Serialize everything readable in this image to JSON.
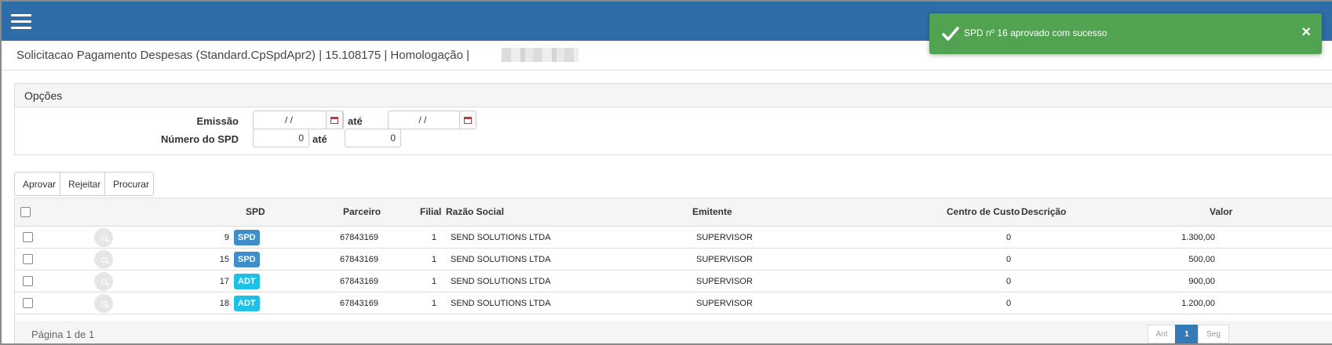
{
  "header": {
    "menu_icon": "hamburger-menu-icon",
    "bg_color": "#2f6da8"
  },
  "page": {
    "title": "Solicitacao Pagamento Despesas (Standard.CpSpdApr2) | 15.108175 | Homologação |"
  },
  "options": {
    "heading": "Opções",
    "emissao_label": "Emissão",
    "emissao_from": "/ /",
    "emissao_to": "/ /",
    "ate_label": "até",
    "numero_label": "Número do SPD",
    "numero_from": "0",
    "numero_to": "0",
    "calendar_icon": "calendar-icon"
  },
  "actions": {
    "approve": "Aprovar",
    "reject": "Rejeitar",
    "search": "Procurar"
  },
  "table": {
    "columns": {
      "spd": "SPD",
      "parceiro": "Parceiro",
      "filial": "Filial",
      "razao": "Razão Social",
      "emitente": "Emitente",
      "centro": "Centro de Custo",
      "descricao": "Descrição",
      "valor": "Valor"
    },
    "rows": [
      {
        "spd": "9",
        "type": "SPD",
        "parceiro": "67843169",
        "filial": "1",
        "razao": "SEND SOLUTIONS LTDA",
        "emitente": "SUPERVISOR",
        "centro": "0",
        "descricao": "",
        "valor": "1.300,00"
      },
      {
        "spd": "15",
        "type": "SPD",
        "parceiro": "67843169",
        "filial": "1",
        "razao": "SEND SOLUTIONS LTDA",
        "emitente": "SUPERVISOR",
        "centro": "0",
        "descricao": "",
        "valor": "500,00"
      },
      {
        "spd": "17",
        "type": "ADT",
        "parceiro": "67843169",
        "filial": "1",
        "razao": "SEND SOLUTIONS LTDA",
        "emitente": "SUPERVISOR",
        "centro": "0",
        "descricao": "",
        "valor": "900,00"
      },
      {
        "spd": "18",
        "type": "ADT",
        "parceiro": "67843169",
        "filial": "1",
        "razao": "SEND SOLUTIONS LTDA",
        "emitente": "SUPERVISOR",
        "centro": "0",
        "descricao": "",
        "valor": "1.200,00"
      }
    ],
    "badge_colors": {
      "SPD": "#3d8ec9",
      "ADT": "#1ec0e8"
    }
  },
  "pagination": {
    "info": "Página 1 de 1",
    "prev": "Ant",
    "current": "1",
    "next": "Seg"
  },
  "toast": {
    "message": "SPD nº 16 aprovado com sucesso",
    "close": "×",
    "color": "#51a351",
    "icon": "check-icon"
  }
}
